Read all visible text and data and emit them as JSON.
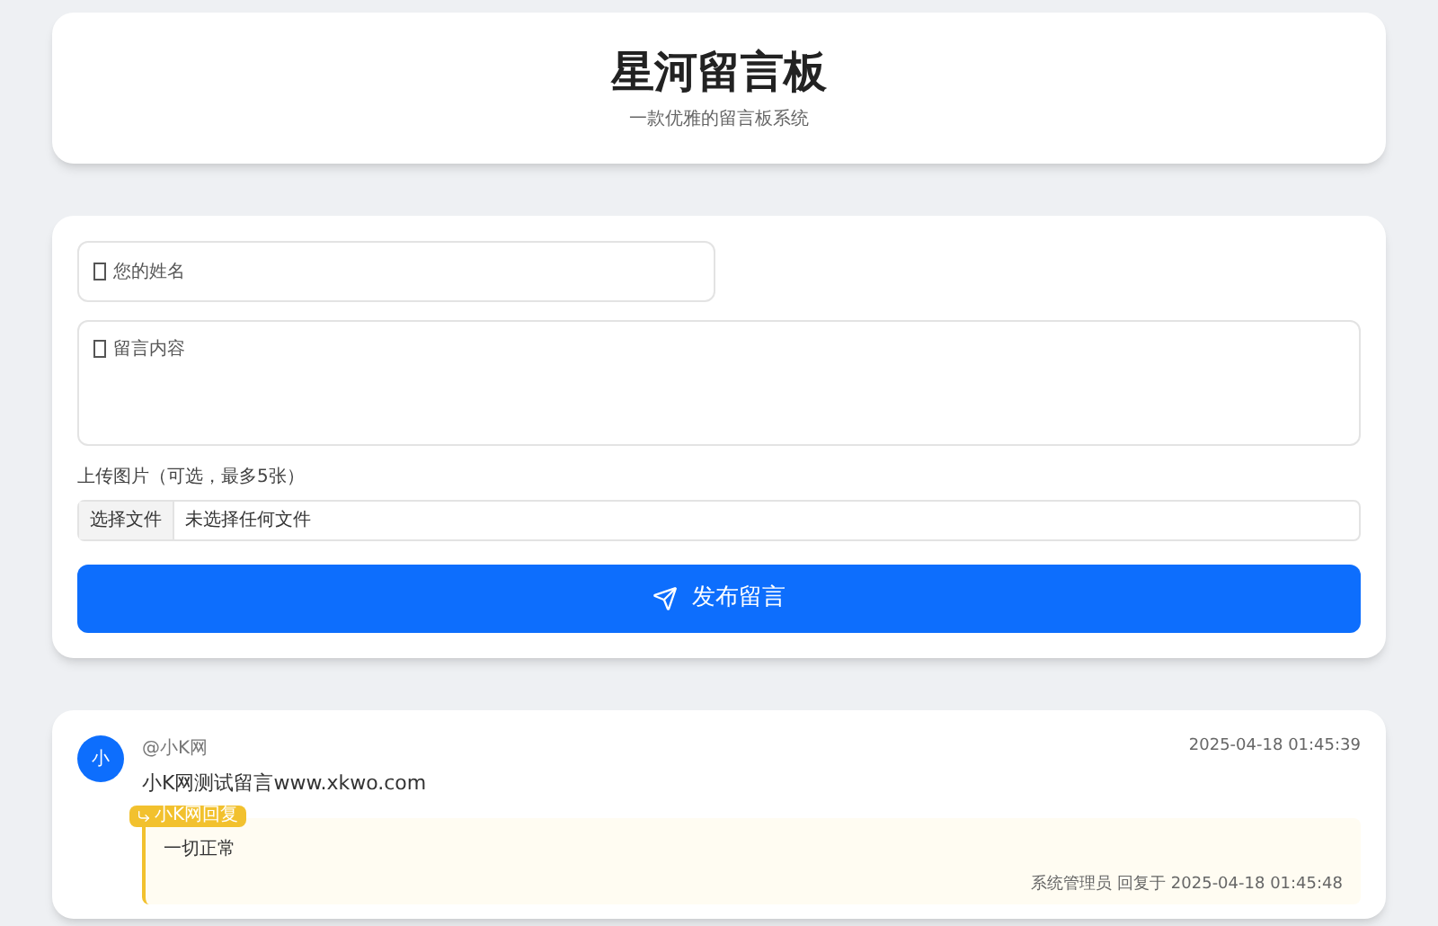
{
  "header": {
    "title": "星河留言板",
    "subtitle": "一款优雅的留言板系统"
  },
  "form": {
    "name_placeholder": "您的姓名",
    "content_placeholder": "留言内容",
    "upload_label": "上传图片（可选，最多5张）",
    "file_button": "选择文件",
    "file_status": "未选择任何文件",
    "submit": "发布留言"
  },
  "messages": [
    {
      "avatar": "小",
      "author": "@小K网",
      "time": "2025-04-18 01:45:39",
      "text": "小K网测试留言www.xkwo.com",
      "reply": {
        "badge": "小K网回复",
        "text": "一切正常",
        "meta": "系统管理员 回复于 2025-04-18 01:45:48"
      }
    }
  ]
}
